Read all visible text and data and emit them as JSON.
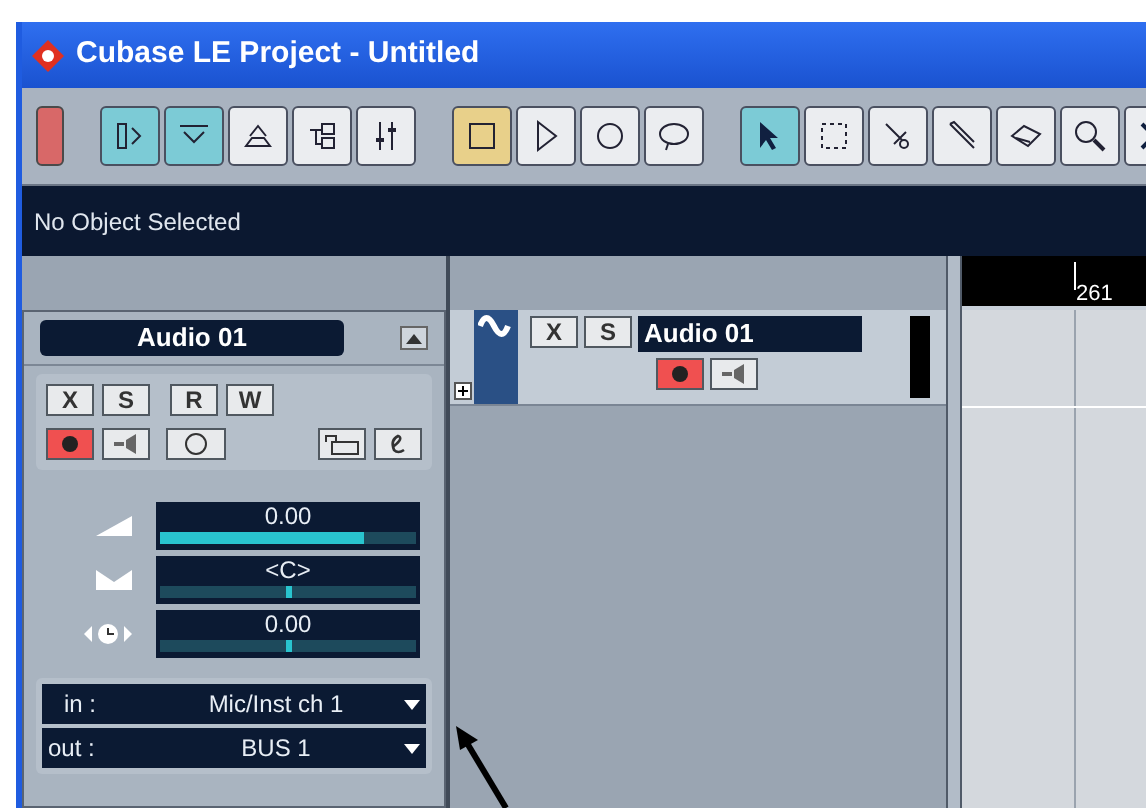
{
  "window": {
    "title": "Cubase LE Project - Untitled"
  },
  "toolbar": {
    "groups": [
      {
        "buttons": [
          {
            "kind": "activate",
            "selected": false
          }
        ]
      },
      {
        "buttons": [
          {
            "kind": "inspector",
            "selected": true
          },
          {
            "kind": "infoline",
            "selected": true
          },
          {
            "kind": "overview",
            "selected": false
          },
          {
            "kind": "pool",
            "selected": false
          },
          {
            "kind": "mixer",
            "selected": false
          }
        ]
      },
      {
        "buttons": [
          {
            "kind": "stop",
            "selected": true
          },
          {
            "kind": "play",
            "selected": false
          },
          {
            "kind": "record",
            "selected": false
          },
          {
            "kind": "cycle",
            "selected": false
          }
        ]
      },
      {
        "buttons": [
          {
            "kind": "pointer",
            "selected": true
          },
          {
            "kind": "range",
            "selected": false
          },
          {
            "kind": "split",
            "selected": false
          },
          {
            "kind": "pencil",
            "selected": false
          },
          {
            "kind": "eraser",
            "selected": false
          },
          {
            "kind": "zoom",
            "selected": false
          },
          {
            "kind": "mute",
            "selected": false
          }
        ]
      }
    ]
  },
  "info_line": "No Object Selected",
  "inspector": {
    "track_name": "Audio 01",
    "buttons": [
      {
        "label": "X"
      },
      {
        "label": "S"
      },
      {
        "label": "R"
      },
      {
        "label": "W"
      }
    ],
    "record_enabled": true,
    "faders": [
      {
        "kind": "volume",
        "reading": "0.00",
        "level": 0.8
      },
      {
        "kind": "pan",
        "reading": "<C>",
        "level": 0.5
      },
      {
        "kind": "delay",
        "reading": "0.00",
        "level": 0.5
      }
    ],
    "routing": [
      {
        "label": "in :",
        "value": "Mic/Inst ch 1"
      },
      {
        "label": "out :",
        "value": "BUS 1"
      }
    ]
  },
  "track": {
    "buttons": [
      {
        "label": "X"
      },
      {
        "label": "S"
      }
    ],
    "name": "Audio 01",
    "record_enabled": true
  },
  "ruler": {
    "marker": "261"
  }
}
